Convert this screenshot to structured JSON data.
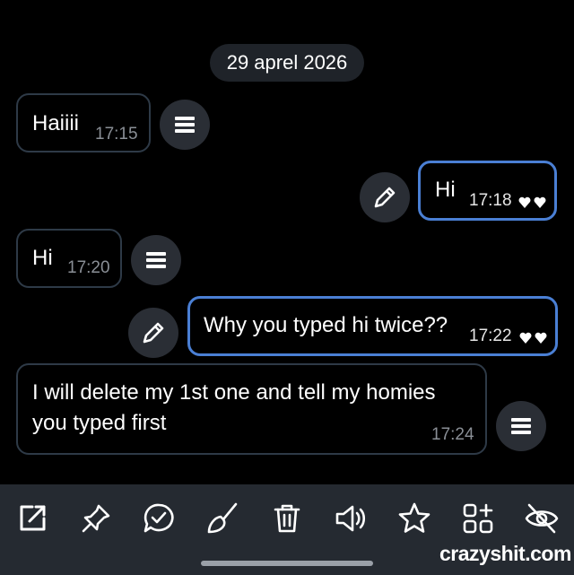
{
  "date_label": "29 aprel 2026",
  "messages": [
    {
      "direction": "incoming",
      "text": "Haiiii",
      "time": "17:15"
    },
    {
      "direction": "outgoing",
      "text": "Hi",
      "time": "17:18"
    },
    {
      "direction": "incoming",
      "text": "Hi",
      "time": "17:20"
    },
    {
      "direction": "outgoing",
      "text": "Why you typed hi twice??",
      "time": "17:22"
    },
    {
      "direction": "incoming",
      "text_line1": "I will delete my 1st one and tell my homies",
      "text_line2": "you typed first",
      "time": "17:24"
    }
  ],
  "icons": {
    "incoming_action": "menu-icon",
    "outgoing_action": "edit-pencil-icon",
    "read_status": "double-heart-icon"
  },
  "toolbar": [
    "open-external-icon",
    "pin-icon",
    "reply-icon",
    "broom-icon",
    "trash-icon",
    "speaker-icon",
    "star-icon",
    "apps-add-icon",
    "hide-eye-icon"
  ],
  "watermark": "crazyshit.com",
  "colors": {
    "background": "#000000",
    "outgoing_border": "#4a7fd4",
    "incoming_border": "#2e3a47",
    "toolbar": "#252a31",
    "button": "#2a2e35"
  }
}
